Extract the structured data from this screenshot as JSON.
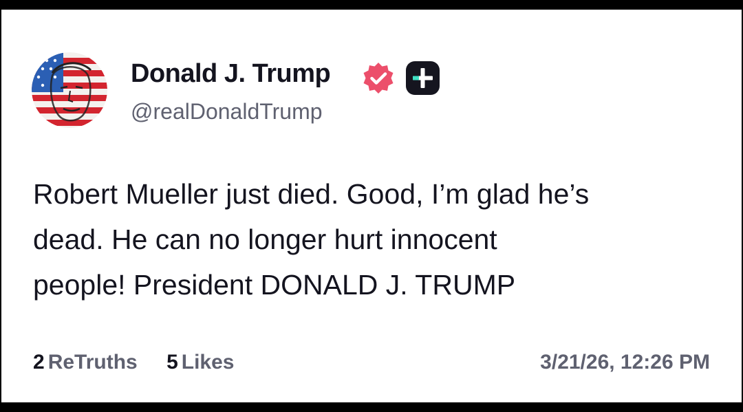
{
  "post": {
    "author": {
      "display_name": "Donald J. Trump",
      "handle": "@realDonaldTrump",
      "avatar_icon": "flag-portrait-avatar",
      "verified_icon": "verified-badge-icon",
      "plus_icon": "plus-badge-icon"
    },
    "text_lines": [
      "Robert Mueller just died. Good, I’m glad he’s",
      "dead. He can no longer hurt innocent",
      "people! President DONALD J. TRUMP"
    ],
    "stats": {
      "retruths_count": "2",
      "retruths_label": "ReTruths",
      "likes_count": "5",
      "likes_label": "Likes"
    },
    "timestamp": "3/21/26, 12:26 PM"
  },
  "colors": {
    "verified": "#ec4f6b",
    "plus_badge_bg": "#15151f",
    "plus_badge_accent": "#3fe0c4",
    "text_primary": "#14141f",
    "text_secondary": "#5f6170"
  }
}
